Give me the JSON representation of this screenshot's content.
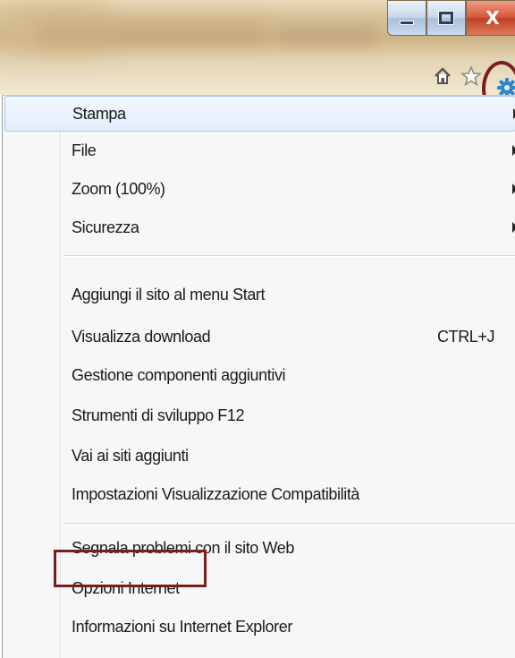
{
  "window": {
    "minimize_icon": "minimize-icon",
    "maximize_icon": "maximize-icon",
    "close_label": "X"
  },
  "command_bar": {
    "icons": [
      "home-icon",
      "star-icon",
      "gear-icon"
    ]
  },
  "menu": {
    "items": [
      {
        "label": "Stampa",
        "submenu": true
      },
      {
        "label": "File",
        "submenu": true
      },
      {
        "label": "Zoom (100%)",
        "submenu": true
      },
      {
        "label": "Sicurezza",
        "submenu": true
      },
      {
        "label": "Aggiungi il sito al menu Start"
      },
      {
        "label": "Visualizza download",
        "shortcut": "CTRL+J"
      },
      {
        "label": "Gestione componenti aggiuntivi"
      },
      {
        "label": "Strumenti di sviluppo F12"
      },
      {
        "label": "Vai ai siti aggiunti"
      },
      {
        "label": "Impostazioni Visualizzazione Compatibilità"
      },
      {
        "label": "Segnala problemi con il sito Web"
      },
      {
        "label": "Opzioni Internet"
      },
      {
        "label": "Informazioni su Internet Explorer"
      }
    ],
    "highlight_color": "#7b1d1d",
    "hover_color": "#e3edfa"
  }
}
